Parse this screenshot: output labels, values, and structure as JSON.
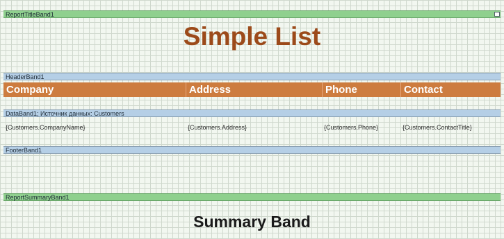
{
  "report_title_band": {
    "label": "ReportTitleBand1",
    "title": "Simple List"
  },
  "header_band": {
    "label": "HeaderBand1",
    "columns": [
      "Company",
      "Address",
      "Phone",
      "Contact"
    ]
  },
  "data_band": {
    "label": "DataBand1; Источник данных: Customers",
    "cells": [
      "{Customers.CompanyName}",
      "{Customers.Address}",
      "{Customers.Phone}",
      "{Customers.ContactTitle}"
    ]
  },
  "footer_band": {
    "label": "FooterBand1"
  },
  "summary_band": {
    "label": "ReportSummaryBand1",
    "text": "Summary Band"
  },
  "colors": {
    "title": "#9c4a1a",
    "header_fill": "#cd7c3f",
    "band_green": "#8fd08e",
    "band_blue": "#b5cfe6"
  }
}
